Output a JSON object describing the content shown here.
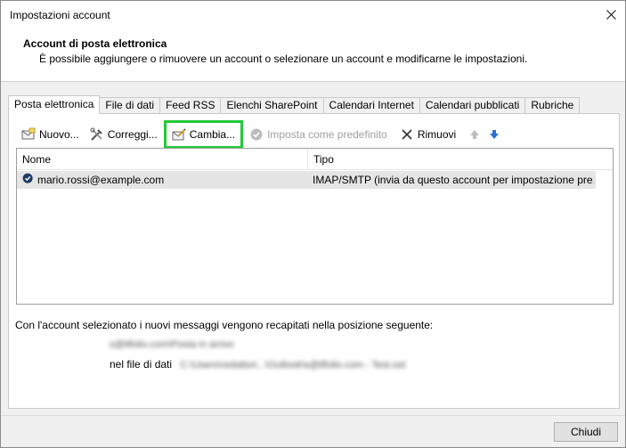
{
  "window": {
    "title": "Impostazioni account"
  },
  "header": {
    "title": "Account di posta elettronica",
    "description": "È possibile aggiungere o rimuovere un account o selezionare un account e modificarne le impostazioni."
  },
  "tabs": [
    {
      "label": "Posta elettronica",
      "active": true
    },
    {
      "label": "File di dati",
      "active": false
    },
    {
      "label": "Feed RSS",
      "active": false
    },
    {
      "label": "Elenchi SharePoint",
      "active": false
    },
    {
      "label": "Calendari Internet",
      "active": false
    },
    {
      "label": "Calendari pubblicati",
      "active": false
    },
    {
      "label": "Rubriche",
      "active": false
    }
  ],
  "toolbar": {
    "new_label": "Nuovo...",
    "repair_label": "Correggi...",
    "change_label": "Cambia...",
    "set_default_label": "Imposta come predefinito",
    "remove_label": "Rimuovi",
    "highlight_color": "#22c93a"
  },
  "list": {
    "columns": [
      "Nome",
      "Tipo"
    ],
    "rows": [
      {
        "name": "mario.rossi@example.com",
        "type": "IMAP/SMTP (invia da questo account per impostazione pre..."
      }
    ]
  },
  "delivery": {
    "info": "Con l'account selezionato i nuovi messaggi vengono recapitati nella posizione seguente:",
    "folder_blurred": "s@tlfolio.com\\Posta in arrivo",
    "datafile_label": "nel file di dati",
    "datafile_blurred": "C:\\Users\\redattori...\\Outlook\\s@tlfolio.com - Test.ost"
  },
  "footer": {
    "close_label": "Chiudi"
  }
}
